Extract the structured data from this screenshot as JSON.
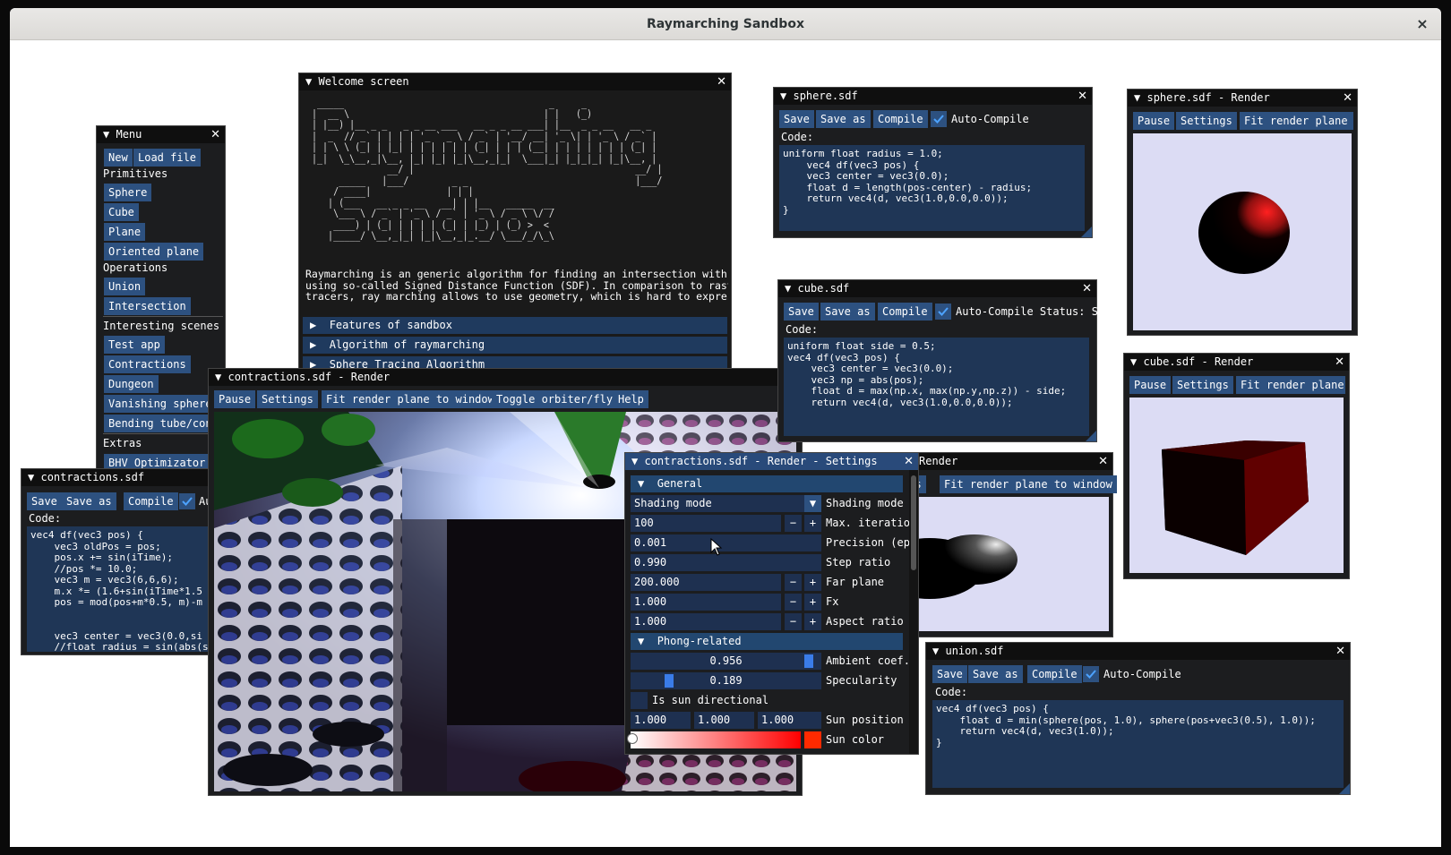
{
  "app": {
    "title": "Raymarching Sandbox",
    "close": "×"
  },
  "common": {
    "close": "✕",
    "triangle": "▼",
    "triangle_right": "▶"
  },
  "menu": {
    "title": "Menu",
    "new": "New",
    "load": "Load file",
    "primitives": "Primitives",
    "sphere": "Sphere",
    "cube": "Cube",
    "plane": "Plane",
    "oriented_plane": "Oriented plane",
    "operations": "Operations",
    "union": "Union",
    "intersection": "Intersection",
    "interesting": "Interesting scenes",
    "test_app": "Test app",
    "contractions": "Contractions",
    "dungeon": "Dungeon",
    "vanishing": "Vanishing spheres",
    "bending": "Bending tube/cone",
    "extras": "Extras",
    "bhv": "BHV Optimizator"
  },
  "welcome": {
    "title": "Welcome screen",
    "ascii": " _____                                      _     _\n|  __ \\                                    | |   (_)\n| |__) |__ _ _   _ _ __ ___   __ _ _ __ ___| |__  _ _ __   __ _\n|  _  // _` | | | | '_ ` _ \\ / _` | '__/ __| '_ \\| | '_ \\ / _` |\n| | \\ \\ (_| | |_| | | | | | | (_| | | | (__| | | | | | | | (_| |\n|_|  \\_\\__,_|\\__, |_| |_| |_|\\__,_|_|  \\___|_| |_|_|_| |_|\\__, |\n              __/ |                                         __/ |\n     _____   |___/        _ _                               |___/\n    / ____|              | | |\n   | (___   __ _ _ __   __| | |__   _____  __\n    \\___ \\ / _` | '_ \\ / _` | '_ \\ / _ \\ \\/ /\n    ____) | (_| | | | | (_| | |_) | (_) >  <\n   |_____/ \\__,_|_| |_|\\__,_|_.__/ \\___/_/\\_\\",
    "para": "Raymarching is an generic algorithm for finding an intersection with a\nusing so-called Signed Distance Function (SDF). In comparison to raste\ntracers, ray marching allows to use geometry, which is hard to express",
    "features": "Features of sandbox",
    "algorithm": "Algorithm of raymarching",
    "sphere_tracing": "Sphere Tracing Algorithm"
  },
  "sphere_sdf": {
    "title": "sphere.sdf",
    "save": "Save",
    "save_as": "Save as",
    "compile": "Compile",
    "auto": "Auto-Compile",
    "code_label": "Code:",
    "code": "uniform float radius = 1.0;\n    vec4 df(vec3 pos) {\n    vec3 center = vec3(0.0);\n    float d = length(pos-center) - radius;\n    return vec4(d, vec3(1.0,0.0,0.0));\n}"
  },
  "sphere_render": {
    "title": "sphere.sdf - Render",
    "pause": "Pause",
    "settings": "Settings",
    "fit": "Fit render plane t"
  },
  "cube_sdf": {
    "title": "cube.sdf",
    "save": "Save",
    "save_as": "Save as",
    "compile": "Compile",
    "auto": "Auto-Compile Status: Sa",
    "code_label": "Code:",
    "code": "uniform float side = 0.5;\nvec4 df(vec3 pos) {\n    vec3 center = vec3(0.0);\n    vec3 np = abs(pos);\n    float d = max(np.x, max(np.y,np.z)) - side;\n    return vec4(d, vec3(1.0,0.0,0.0));"
  },
  "cube_render": {
    "title": "cube.sdf - Render",
    "pause": "Pause",
    "settings": "Settings",
    "fit": "Fit render plane t"
  },
  "union_render": {
    "title": "Render",
    "settings_partial": "ngs",
    "fit": "Fit render plane to window"
  },
  "union_sdf": {
    "title": "union.sdf",
    "save": "Save",
    "save_as": "Save as",
    "compile": "Compile",
    "auto": "Auto-Compile",
    "code_label": "Code:",
    "code": "vec4 df(vec3 pos) {\n    float d = min(sphere(pos, 1.0), sphere(pos+vec3(0.5), 1.0));\n    return vec4(d, vec3(1.0));\n}"
  },
  "contr_sdf": {
    "title": "contractions.sdf",
    "save": "Save",
    "save_as": "Save as",
    "compile": "Compile",
    "auto": "Au",
    "code_label": "Code:",
    "code": "vec4 df(vec3 pos) {\n    vec3 oldPos = pos;\n    pos.x += sin(iTime);\n    //pos *= 10.0;\n    vec3 m = vec3(6,6,6);\n    m.x *= (1.6+sin(iTime*1.5\n    pos = mod(pos+m*0.5, m)-m\n\n\n    vec3 center = vec3(0.0,si\n    //float radius = sin(abs(s"
  },
  "contr_render": {
    "title": "contractions.sdf - Render",
    "pause": "Pause",
    "settings": "Settings",
    "fit": "Fit render plane to window",
    "toggle": "Toggle orbiter/fly",
    "help": "Help"
  },
  "settings": {
    "title": "contractions.sdf - Render  - Settings",
    "general": "General",
    "shading_value": "Shading mode",
    "shading_label": "Shading mode",
    "max_iter_value": "100",
    "max_iter_label": "Max. iteratio",
    "precision_value": "0.001",
    "precision_label": "Precision (ep",
    "step_value": "0.990",
    "step_label": "Step ratio",
    "far_value": "200.000",
    "far_label": "Far plane",
    "fx_value": "1.000",
    "fx_label": "Fx",
    "aspect_value": "1.000",
    "aspect_label": "Aspect ratio",
    "minus": "−",
    "plus": "+",
    "phong": "Phong-related",
    "ambient_value": "0.956",
    "ambient_label": "Ambient coef.",
    "ambient_level": 0.956,
    "specularity_value": "0.189",
    "specularity_label": "Specularity",
    "specularity_level": 0.189,
    "sun_dir_label": "Is sun directional",
    "sun_x": "1.000",
    "sun_y": "1.000",
    "sun_z": "1.000",
    "sun_pos_label": "Sun position",
    "sun_color_label": "Sun color"
  },
  "colors": {
    "title_active": "#294a7a",
    "button": "#2d5180",
    "window_bg": "#1c1d1f",
    "render_bg": "#dcdcf4"
  }
}
